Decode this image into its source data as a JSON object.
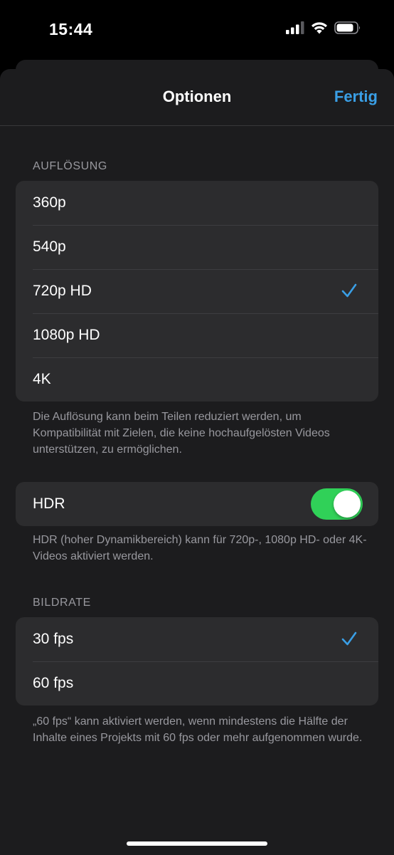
{
  "status_bar": {
    "time": "15:44"
  },
  "nav": {
    "title": "Optionen",
    "done_label": "Fertig"
  },
  "resolution": {
    "header": "AUFLÖSUNG",
    "options": [
      "360p",
      "540p",
      "720p HD",
      "1080p HD",
      "4K"
    ],
    "selected": "720p HD",
    "footer": "Die Auflösung kann beim Teilen reduziert werden, um Kompatibilität mit Zielen, die keine hochaufgelösten Videos unterstützen, zu ermöglichen."
  },
  "hdr": {
    "label": "HDR",
    "enabled": true,
    "footer": "HDR (hoher Dynamikbereich) kann für 720p-, 1080p HD- oder 4K-Videos aktiviert werden."
  },
  "framerate": {
    "header": "BILDRATE",
    "options": [
      "30 fps",
      "60 fps"
    ],
    "selected": "30 fps",
    "footer": "„60 fps“ kann aktiviert werden, wenn mindestens die Hälfte der Inhalte eines Projekts mit 60 fps oder mehr aufgenommen wurde."
  },
  "colors": {
    "accent": "#3a9fe6",
    "toggle_on": "#30d158",
    "sheet_bg": "#1c1c1e",
    "group_bg": "#2c2c2e"
  },
  "icons": [
    "signal-icon",
    "wifi-icon",
    "battery-icon",
    "checkmark-icon"
  ]
}
